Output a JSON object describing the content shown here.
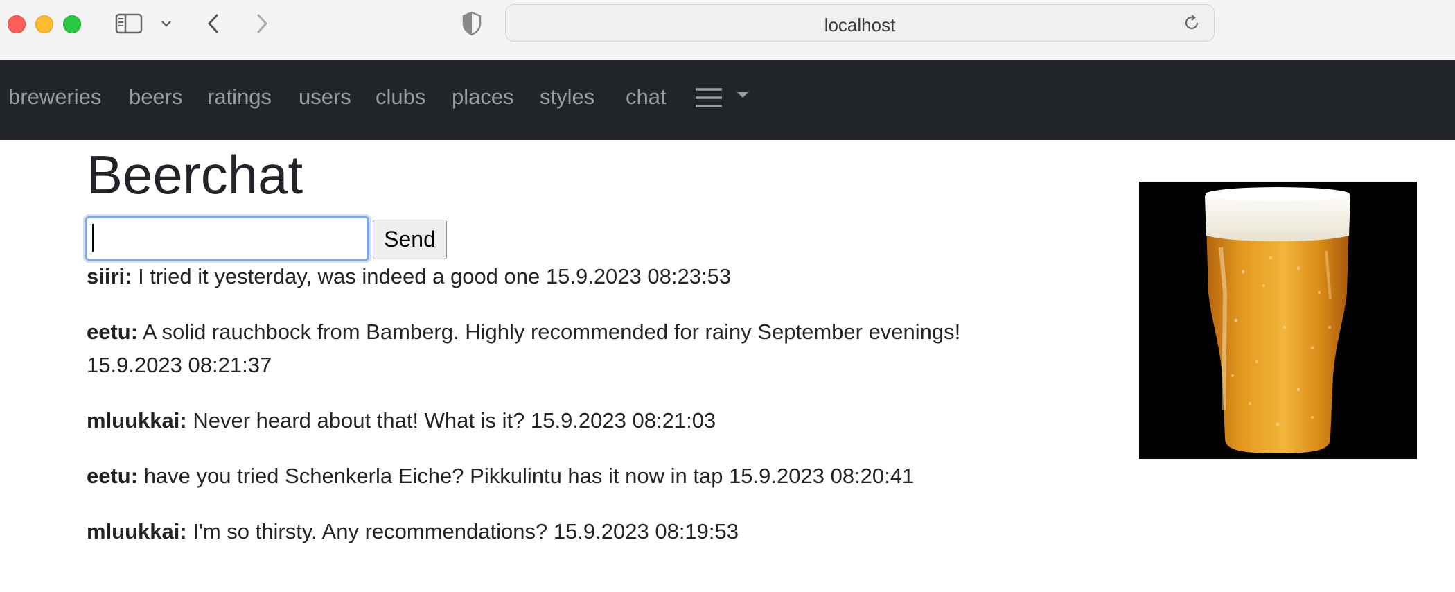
{
  "browser": {
    "url": "localhost"
  },
  "nav": {
    "items": [
      "breweries",
      "beers",
      "ratings",
      "users",
      "clubs",
      "places",
      "styles",
      "chat"
    ]
  },
  "page": {
    "title": "Beerchat"
  },
  "chat": {
    "input_value": "",
    "send_label": "Send",
    "messages": [
      {
        "author": "siiri:",
        "text": " I tried it yesterday, was indeed a good one 15.9.2023 08:23:53"
      },
      {
        "author": "eetu:",
        "text": " A solid rauchbock from Bamberg. Highly recommended for rainy September evenings! 15.9.2023 08:21:37"
      },
      {
        "author": "mluukkai:",
        "text": " Never heard about that! What is it? 15.9.2023 08:21:03"
      },
      {
        "author": "eetu:",
        "text": " have you tried Schenkerla Eiche? Pikkulintu has it now in tap 15.9.2023 08:20:41"
      },
      {
        "author": "mluukkai:",
        "text": " I'm so thirsty. Any recommendations? 15.9.2023 08:19:53"
      }
    ]
  },
  "colors": {
    "navbar_bg": "#212529",
    "focus_ring": "#7aa7ee"
  },
  "icons": {
    "sidebar": "sidebar-icon",
    "back": "chevron-left-icon",
    "forward": "chevron-right-icon",
    "privacy": "shield-icon",
    "reload": "reload-icon",
    "menu": "hamburger-icon"
  }
}
